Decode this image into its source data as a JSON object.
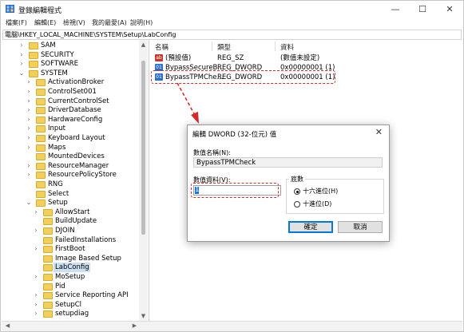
{
  "window": {
    "title": "登錄編輯程式",
    "controls": {
      "minimize": "—",
      "maximize": "☐",
      "close": "✕"
    }
  },
  "menu": [
    "檔案(F)",
    "編輯(E)",
    "檢視(V)",
    "我的最愛(A)",
    "說明(H)"
  ],
  "address": "電腦\\HKEY_LOCAL_MACHINE\\SYSTEM\\Setup\\LabConfig",
  "tree": {
    "level1": [
      {
        "label": "SAM",
        "chev": "›"
      },
      {
        "label": "SECURITY",
        "chev": "›"
      },
      {
        "label": "SOFTWARE",
        "chev": "›"
      },
      {
        "label": "SYSTEM",
        "chev": "⌄"
      }
    ],
    "level2": [
      {
        "label": "ActivationBroker",
        "chev": "›"
      },
      {
        "label": "ControlSet001",
        "chev": "›"
      },
      {
        "label": "CurrentControlSet",
        "chev": "›"
      },
      {
        "label": "DriverDatabase",
        "chev": "›"
      },
      {
        "label": "HardwareConfig",
        "chev": "›"
      },
      {
        "label": "Input",
        "chev": "›"
      },
      {
        "label": "Keyboard Layout",
        "chev": "›"
      },
      {
        "label": "Maps",
        "chev": "›"
      },
      {
        "label": "MountedDevices",
        "chev": ""
      },
      {
        "label": "ResourceManager",
        "chev": "›"
      },
      {
        "label": "ResourcePolicyStore",
        "chev": "›"
      },
      {
        "label": "RNG",
        "chev": ""
      },
      {
        "label": "Select",
        "chev": ""
      },
      {
        "label": "Setup",
        "chev": "⌄"
      }
    ],
    "level3": [
      {
        "label": "AllowStart",
        "chev": "›"
      },
      {
        "label": "BuildUpdate",
        "chev": ""
      },
      {
        "label": "DJOIN",
        "chev": "›"
      },
      {
        "label": "FailedInstallations",
        "chev": ""
      },
      {
        "label": "FirstBoot",
        "chev": "›"
      },
      {
        "label": "Image Based Setup",
        "chev": ""
      },
      {
        "label": "LabConfig",
        "chev": "",
        "selected": true
      },
      {
        "label": "MoSetup",
        "chev": "›"
      },
      {
        "label": "Pid",
        "chev": ""
      },
      {
        "label": "Service Reporting API",
        "chev": "›"
      },
      {
        "label": "SetupCl",
        "chev": "›"
      },
      {
        "label": "setupdiag",
        "chev": "›"
      }
    ]
  },
  "values": {
    "headers": [
      "名稱",
      "類型",
      "資料"
    ],
    "rows": [
      {
        "icon": "ab",
        "name": "(預設值)",
        "type": "REG_SZ",
        "data": "(數值未設定)"
      },
      {
        "icon": "01",
        "name": "BypassSecureB...",
        "type": "REG_DWORD",
        "data": "0x00000001 (1)"
      },
      {
        "icon": "01",
        "name": "BypassTPMChe...",
        "type": "REG_DWORD",
        "data": "0x00000001 (1)"
      }
    ]
  },
  "dialog": {
    "title": "編輯 DWORD (32-位元) 值",
    "close": "✕",
    "name_label": "數值名稱(N):",
    "name_value": "BypassTPMCheck",
    "data_label": "數值資料(V):",
    "data_value": "1",
    "base_label": "底數",
    "hex_label": "十六進位(H)",
    "dec_label": "十進位(D)",
    "base_selected": "hex",
    "ok": "確定",
    "cancel": "取消"
  },
  "colors": {
    "annotation_red": "#d42a2a",
    "selection": "#cce0f4",
    "folder": "#f2cf5b"
  }
}
